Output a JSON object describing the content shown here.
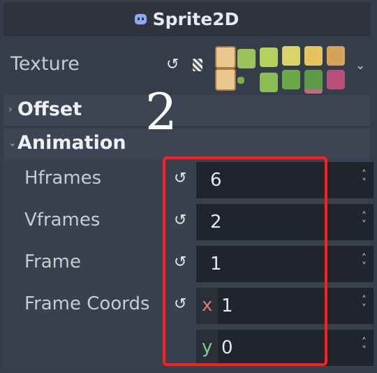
{
  "header": {
    "title": "Sprite2D",
    "icon": "sprite2d-node-icon"
  },
  "texture": {
    "label": "Texture",
    "revert_icon": "revert-icon",
    "type_icon": "texture-type-icon",
    "dropdown_icon": "chevron-down-icon"
  },
  "sections": {
    "offset": {
      "label": "Offset",
      "state": "collapsed"
    },
    "animation": {
      "label": "Animation",
      "state": "expanded"
    }
  },
  "annotation": {
    "number": "2",
    "highlight_color": "#ff1e1e"
  },
  "properties": {
    "hframes": {
      "label": "Hframes",
      "value": "6"
    },
    "vframes": {
      "label": "Vframes",
      "value": "2"
    },
    "frame": {
      "label": "Frame",
      "value": "1"
    },
    "frame_coords": {
      "label": "Frame Coords",
      "x_label": "x",
      "x_value": "1",
      "y_label": "y",
      "y_value": "0"
    }
  },
  "colors": {
    "panel": "#363d4a",
    "field": "#20242c",
    "accent_icon": "#8ea9f4",
    "axis_x": "#e07a6c",
    "axis_y": "#7ccf8a"
  }
}
